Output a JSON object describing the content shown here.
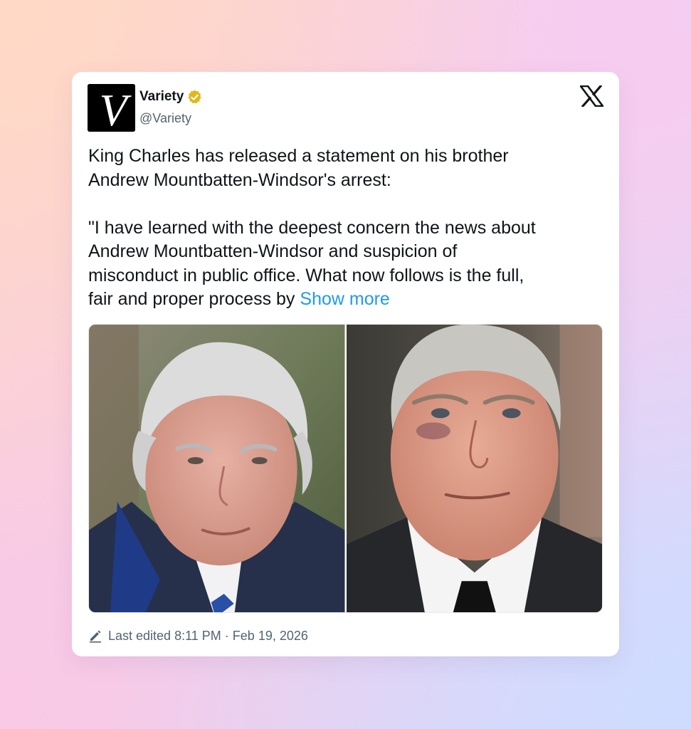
{
  "account": {
    "display_name": "Variety",
    "handle": "@Variety",
    "logo_letter": "V",
    "verified": true,
    "verified_color": "#e2b719"
  },
  "platform": {
    "icon": "x-logo-icon"
  },
  "tweet": {
    "lines_p1": [
      "King Charles has released a statement on his brother",
      "Andrew Mountbatten-Windsor's arrest:"
    ],
    "lines_p2": [
      "\"I have learned with the deepest concern the news about",
      "Andrew Mountbatten-Windsor and suspicion of",
      "misconduct in public office. What now follows is the full,",
      "fair and proper process by"
    ],
    "show_more": "Show more",
    "link_color": "#1d9bf0"
  },
  "media": {
    "images": [
      {
        "subject": "King Charles"
      },
      {
        "subject": "Andrew Mountbatten-Windsor"
      }
    ]
  },
  "footer": {
    "label": "Last edited",
    "time": "8:11 PM",
    "separator": "·",
    "date": "Feb 19, 2026",
    "icon": "pencil-icon"
  }
}
